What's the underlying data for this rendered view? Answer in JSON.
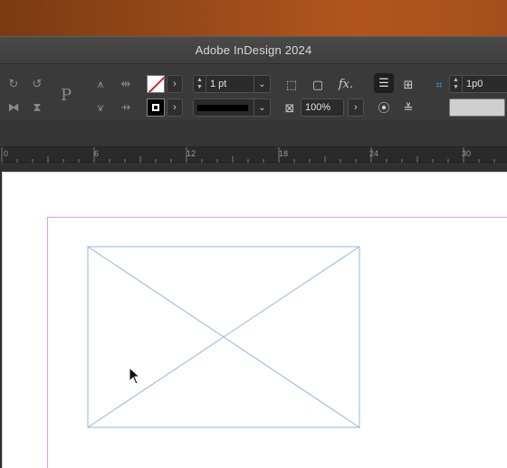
{
  "window": {
    "title": "Adobe InDesign 2024"
  },
  "control_panel": {
    "stroke_weight": "1 pt",
    "scale": "100%",
    "offset": "1p0",
    "colors": {
      "panel_bg": "#3a3a3a",
      "field_bg": "#2b2b2b",
      "none_slash": "#d2262a"
    }
  },
  "ruler": {
    "labels": [
      "0",
      "6",
      "12",
      "18",
      "24",
      "30"
    ]
  },
  "canvas": {
    "margin_guide_color": "#e59be5",
    "frame_color": "#8fb6e3"
  }
}
